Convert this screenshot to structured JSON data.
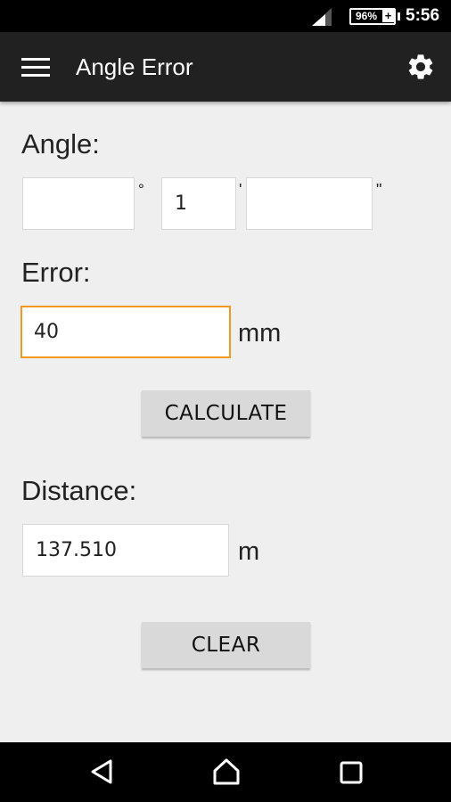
{
  "status_bar": {
    "battery_percent": "96%",
    "battery_charging_symbol": "+",
    "time": "5:56"
  },
  "app_bar": {
    "title": "Angle Error",
    "menu_icon": "hamburger-menu-icon",
    "settings_icon": "gear-icon"
  },
  "angle": {
    "label": "Angle:",
    "degrees_value": "",
    "degrees_symbol": "°",
    "minutes_value": "1",
    "minutes_symbol": "'",
    "seconds_value": "",
    "seconds_symbol": "\""
  },
  "error": {
    "label": "Error:",
    "value": "40",
    "unit": "mm"
  },
  "calculate_button": "CALCULATE",
  "distance": {
    "label": "Distance:",
    "value": "137.510",
    "unit": "m"
  },
  "clear_button": "CLEAR",
  "nav_bar": {
    "back_icon": "back-triangle-icon",
    "home_icon": "home-icon",
    "recents_icon": "recents-square-icon"
  },
  "colors": {
    "app_bar": "#212121",
    "background": "#efefef",
    "focus_accent": "#f39a1e",
    "button": "#d9d9d9"
  }
}
